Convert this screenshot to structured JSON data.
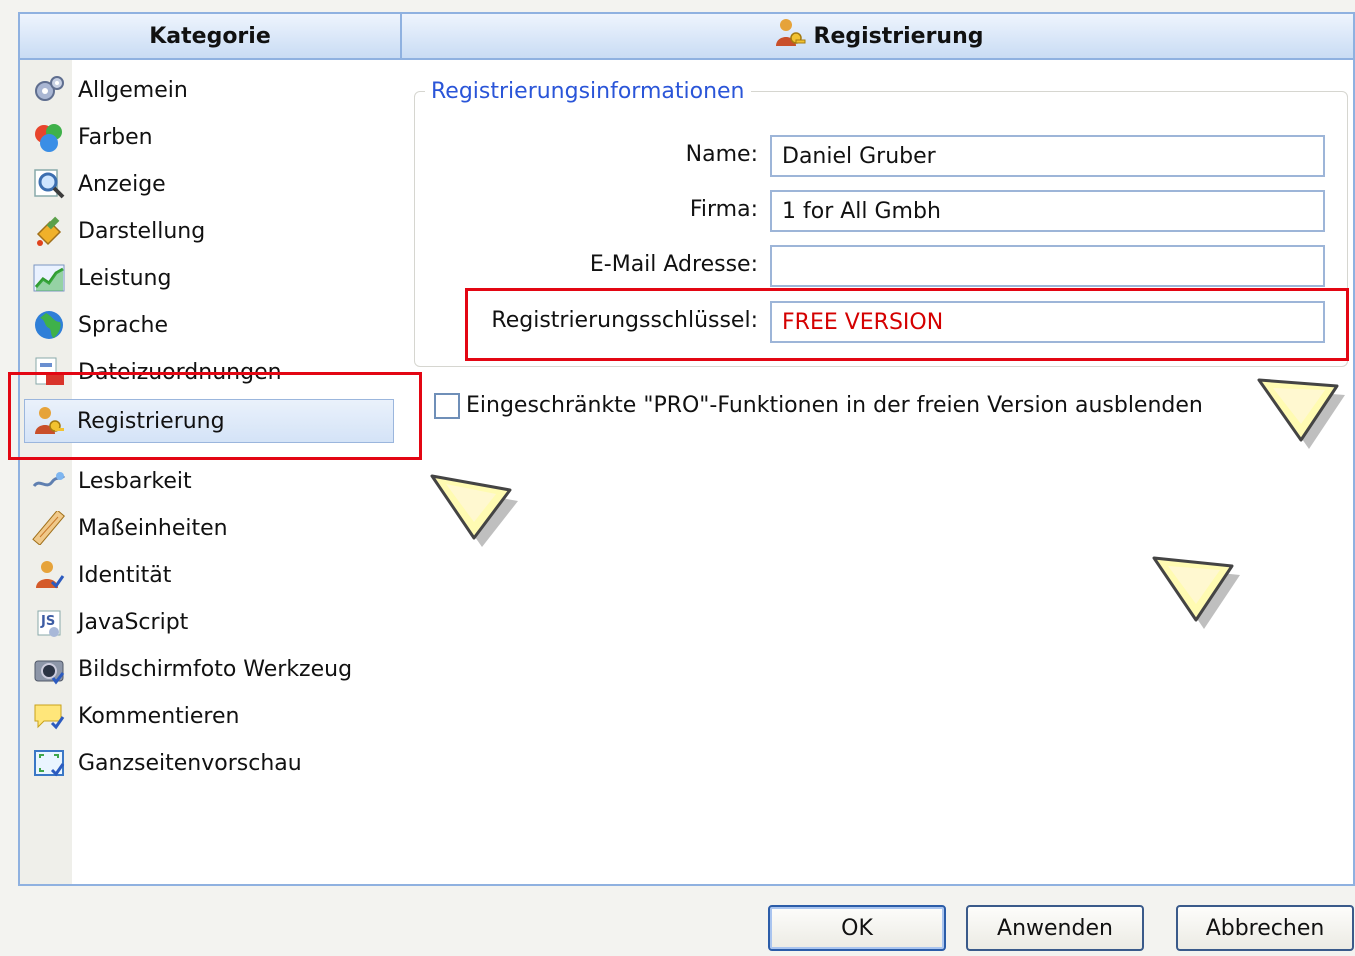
{
  "category_header": "Kategorie",
  "content_header": "Registrierung",
  "categories": [
    {
      "label": "Allgemein",
      "icon": "gears-icon"
    },
    {
      "label": "Farben",
      "icon": "color-balls-icon"
    },
    {
      "label": "Anzeige",
      "icon": "magnifier-icon"
    },
    {
      "label": "Darstellung",
      "icon": "paint-bucket-icon"
    },
    {
      "label": "Leistung",
      "icon": "performance-chart-icon"
    },
    {
      "label": "Sprache",
      "icon": "globe-icon"
    },
    {
      "label": "Dateizuordnungen",
      "icon": "file-association-icon"
    },
    {
      "label": "Registrierung",
      "icon": "user-key-icon"
    },
    {
      "label": "Lesbarkeit",
      "icon": "readability-icon"
    },
    {
      "label": "Maßeinheiten",
      "icon": "ruler-icon"
    },
    {
      "label": "Identität",
      "icon": "identity-icon"
    },
    {
      "label": "JavaScript",
      "icon": "javascript-icon"
    },
    {
      "label": "Bildschirmfoto Werkzeug",
      "icon": "camera-icon"
    },
    {
      "label": "Kommentieren",
      "icon": "comment-icon"
    },
    {
      "label": "Ganzseitenvorschau",
      "icon": "fullpage-preview-icon"
    }
  ],
  "selected_category": "Registrierung",
  "group_title": "Registrierungsinformationen",
  "fields": {
    "name": {
      "label": "Name:",
      "value": "Daniel Gruber"
    },
    "company": {
      "label": "Firma:",
      "value": "1 for All Gmbh"
    },
    "email": {
      "label": "E-Mail Adresse:",
      "value": ""
    },
    "key": {
      "label": "Registrierungsschlüssel:",
      "value": "FREE VERSION"
    }
  },
  "pro_checkbox": {
    "label": "Eingeschränkte \"PRO\"-Funktionen in der freien Version ausblenden",
    "checked": false
  },
  "buttons": {
    "ok": "OK",
    "apply": "Anwenden",
    "cancel": "Abbrechen"
  },
  "colors": {
    "highlight": "#e30613",
    "header": "#c9dcf4",
    "group_title": "#2a55d8",
    "key_value": "#d40000"
  }
}
